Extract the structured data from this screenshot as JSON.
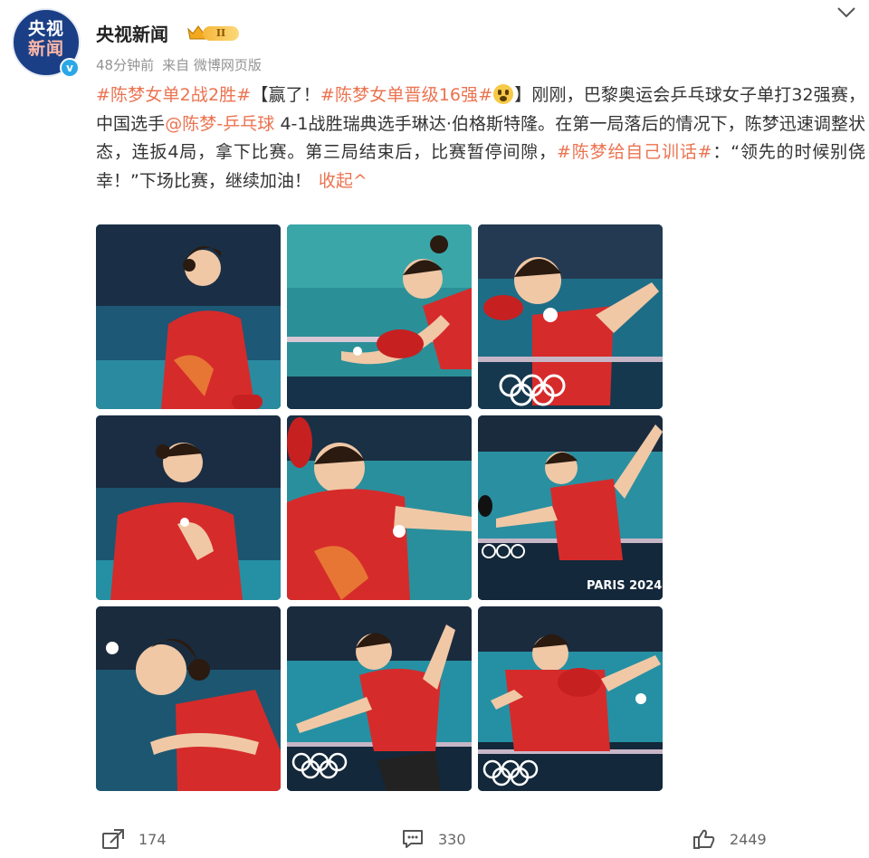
{
  "account": {
    "avatar_lines": [
      "央视",
      "新闻"
    ],
    "verified_mark": "v",
    "name": "央视新闻",
    "level": "II",
    "time": "48分钟前",
    "source": "来自 微博网页版"
  },
  "post": {
    "tag1": "#陈梦女单2战2胜#",
    "t1": "【赢了！",
    "tag2": "#陈梦女单晋级16强#",
    "t2": "】刚刚，巴黎奥运会乒乓球女子单打32强赛，中国选手",
    "mention": "@陈梦-乒乓球",
    "t3": " 4-1战胜瑞典选手琳达·伯格斯特隆。在第一局落后的情况下，陈梦迅速调整状态，连扳4局，拿下比赛。第三局结束后，比赛暂停间隙，",
    "tag3": "#陈梦给自己训话#",
    "t4": "：“领先的时候别侥幸！”下场比赛，继续加油！",
    "collapse": "收起^"
  },
  "photos": [
    {
      "name": "photo-1",
      "icon": "table-tennis-player-photo"
    },
    {
      "name": "photo-2",
      "icon": "table-tennis-player-photo"
    },
    {
      "name": "photo-3",
      "icon": "table-tennis-player-photo"
    },
    {
      "name": "photo-4",
      "icon": "table-tennis-player-photo"
    },
    {
      "name": "photo-5",
      "icon": "table-tennis-player-photo"
    },
    {
      "name": "photo-6",
      "icon": "table-tennis-player-photo"
    },
    {
      "name": "photo-7",
      "icon": "table-tennis-player-photo"
    },
    {
      "name": "photo-8",
      "icon": "table-tennis-player-photo"
    },
    {
      "name": "photo-9",
      "icon": "table-tennis-player-photo"
    }
  ],
  "photo_overlay_text": {
    "photo6_board": "PARIS 2024"
  },
  "actions": {
    "share_count": "174",
    "comment_count": "330",
    "like_count": "2449"
  },
  "colors": {
    "accent": "#eb7350",
    "text": "#333333",
    "meta": "#939393",
    "jersey": "#d62b2b",
    "court": "#1b6f8a"
  },
  "icons": [
    "chevron-down-icon",
    "crown-icon",
    "share-icon",
    "comment-icon",
    "like-icon",
    "verified-icon"
  ]
}
